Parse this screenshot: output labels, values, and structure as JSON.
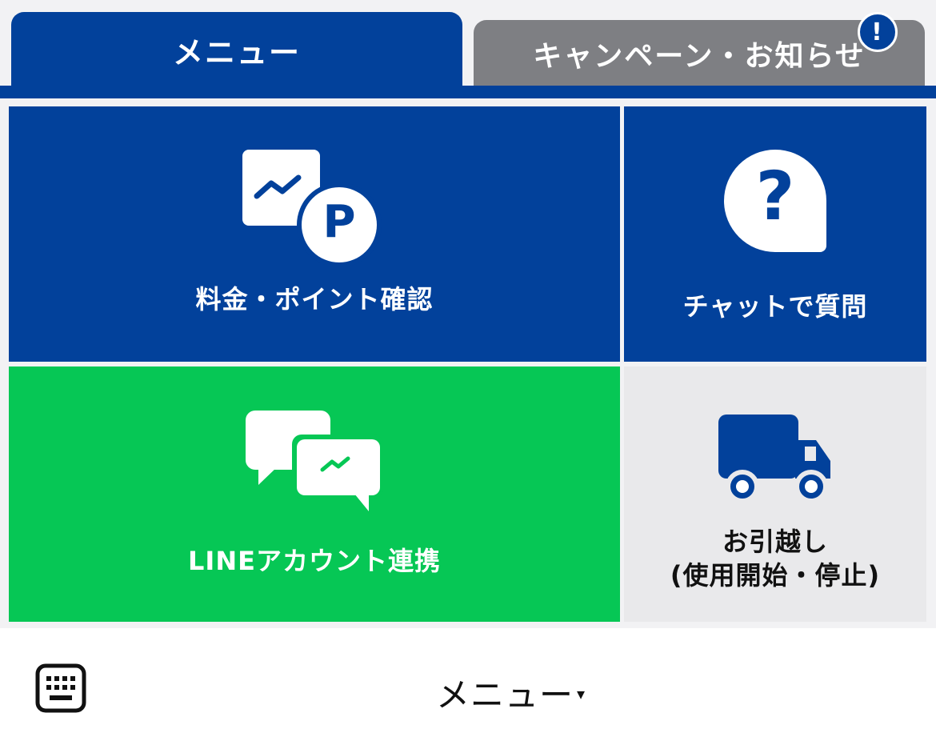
{
  "tabs": {
    "menu_label": "メニュー",
    "news_label": "キャンペーン・お知らせ",
    "news_badge": "!"
  },
  "tiles": {
    "billing_label": "料金・ポイント確認",
    "billing_icon_letter": "P",
    "chat_label": "チャットで質問",
    "chat_icon_glyph": "?",
    "line_label": "LINEアカウント連携",
    "move_label_line1": "お引越し",
    "move_label_line2": "(使用開始・停止)"
  },
  "bottom_bar": {
    "toggle_label": "メニュー",
    "toggle_caret": "▾"
  },
  "colors": {
    "brand_blue": "#02419b",
    "line_green": "#06c755",
    "tab_inactive_gray": "#7e7f83",
    "tile_light_gray": "#e9e9eb"
  },
  "icons": {
    "billing": "chart-with-points-icon",
    "chat": "question-bubble-icon",
    "line": "chat-bubbles-icon",
    "move": "truck-icon",
    "keyboard": "keyboard-icon"
  }
}
